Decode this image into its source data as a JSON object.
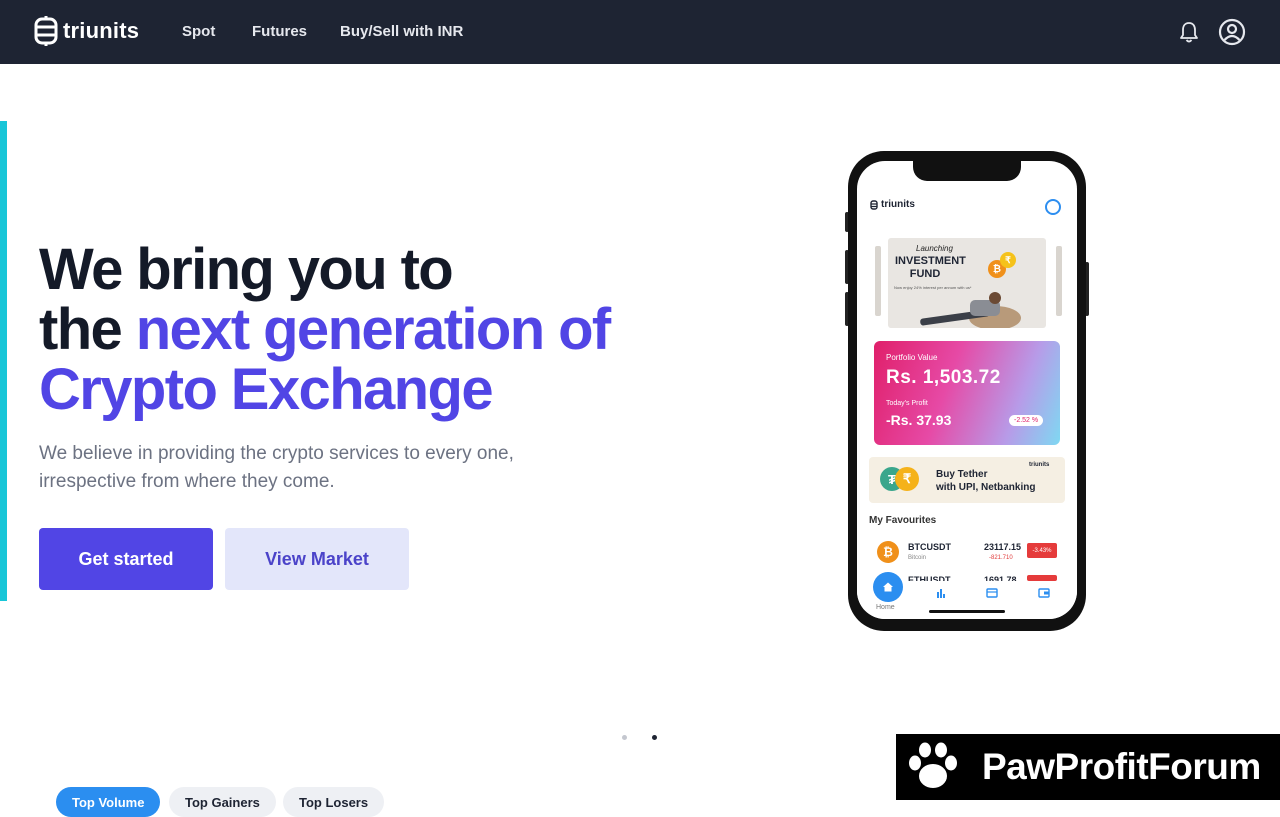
{
  "nav": {
    "logo_text": "triunits",
    "links": [
      "Spot",
      "Futures",
      "Buy/Sell with INR"
    ]
  },
  "hero": {
    "title_line1": "We bring you to",
    "title_line2_plain": "the ",
    "title_line2_highlight": "next generation of",
    "title_line3": "Crypto Exchange",
    "subtitle_line1": "We believe in providing the crypto services to every one,",
    "subtitle_line2": "irrespective from where they come.",
    "primary_button": "Get started",
    "secondary_button": "View Market"
  },
  "phone": {
    "app_logo": "triunits",
    "banner_script": "Launching",
    "banner_title": "INVESTMENT FUND",
    "banner_small": "Now enjoy 24% interest per annum with us*",
    "portfolio_label": "Portfolio Value",
    "portfolio_value": "Rs. 1,503.72",
    "profit_label": "Today's Profit",
    "profit_value": "-Rs. 37.93",
    "profit_pct": "-2.52 %",
    "tether_line1": "Buy Tether",
    "tether_line2": "with UPI, Netbanking",
    "tether_logo": "triunits",
    "favourites_title": "My Favourites",
    "coins": [
      {
        "symbol": "BTCUSDT",
        "name": "Bitcoin",
        "price": "23117.15",
        "change": "-821.710",
        "pct": "-3.43%"
      },
      {
        "symbol": "ETHUSDT",
        "name": "",
        "price": "1691.78",
        "change": "",
        "pct": ""
      }
    ],
    "home_label": "Home"
  },
  "bottom_tabs": [
    "Top Volume",
    "Top Gainers",
    "Top Losers"
  ],
  "watermark": "PawProfitForum",
  "colors": {
    "nav_bg": "#1e2433",
    "accent": "#5145e5",
    "cyan_bar": "#18c6d8"
  }
}
